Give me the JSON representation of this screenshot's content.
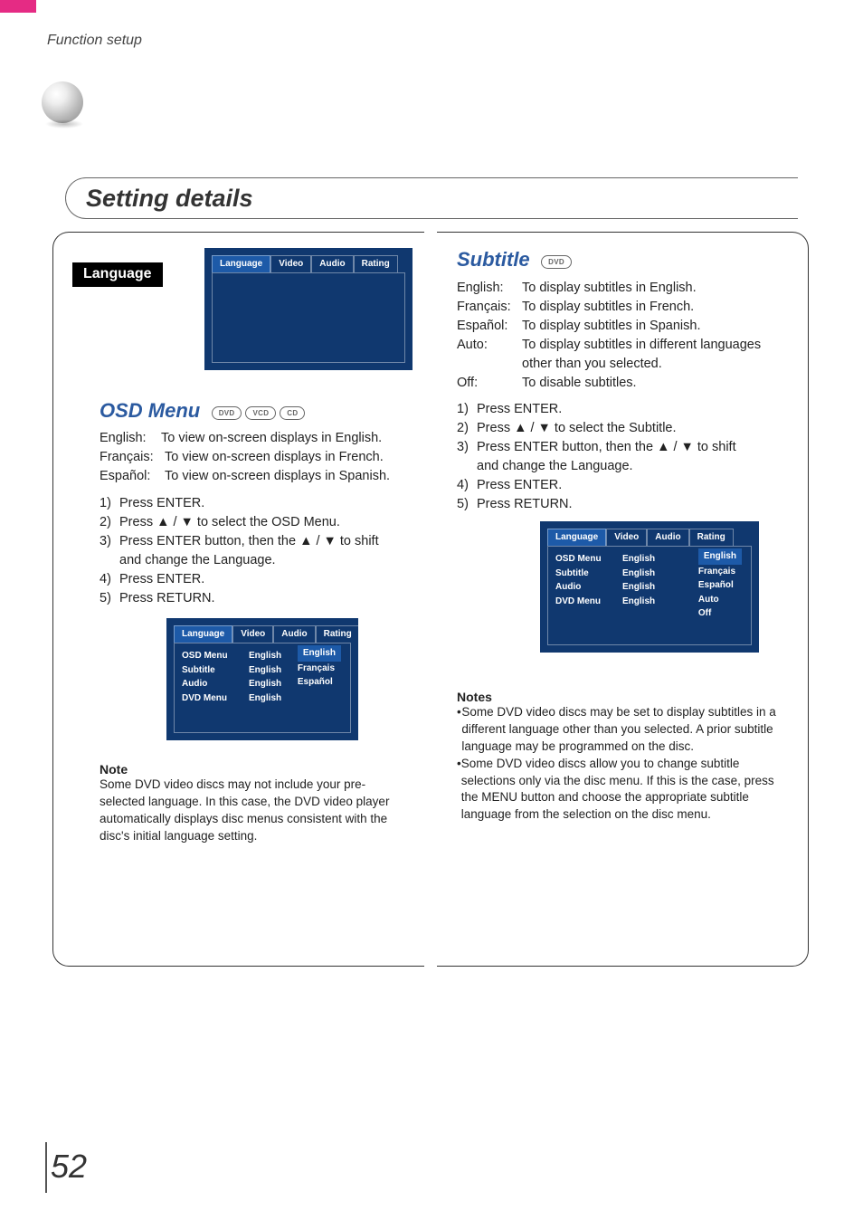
{
  "header": {
    "breadcrumb": "Function setup"
  },
  "title": "Setting details",
  "page_number": "52",
  "left": {
    "language_tag": "Language",
    "osd_tabs_top": [
      "Language",
      "Video",
      "Audio",
      "Rating"
    ],
    "osd_menu": {
      "heading": "OSD Menu",
      "badges": [
        "DVD",
        "VCD",
        "CD"
      ],
      "desc": [
        {
          "k": "English:",
          "v": "To view on-screen displays in English."
        },
        {
          "k": "Français:",
          "v": "To view on-screen displays in French."
        },
        {
          "k": "Español:",
          "v": "To view on-screen displays in Spanish."
        }
      ],
      "steps": [
        "Press ENTER.",
        "Press ▲ / ▼ to select the OSD Menu.",
        "Press ENTER button, then the ▲ / ▼ to shift",
        "and change the Language.",
        "Press ENTER.",
        "Press RETURN."
      ],
      "osd_screenshot": {
        "tabs": [
          "Language",
          "Video",
          "Audio",
          "Rating"
        ],
        "rows": [
          {
            "label": "OSD Menu",
            "val": "English"
          },
          {
            "label": "Subtitle",
            "val": "English"
          },
          {
            "label": "Audio",
            "val": "English"
          },
          {
            "label": "DVD Menu",
            "val": "English"
          }
        ],
        "options": [
          "English",
          "Français",
          "Español"
        ]
      },
      "note_h": "Note",
      "note_p": "Some DVD video discs may not include your pre-selected language. In this case, the DVD video player automatically displays disc menus consistent with the disc's initial language setting."
    }
  },
  "right": {
    "subtitle": {
      "heading": "Subtitle",
      "badges": [
        "DVD"
      ],
      "desc": [
        {
          "k": "English:",
          "v": "To display subtitles in English."
        },
        {
          "k": "Français:",
          "v": "To display subtitles in French."
        },
        {
          "k": "Español:",
          "v": "To display subtitles in Spanish."
        },
        {
          "k": "Auto:",
          "v": "To display subtitles in different languages"
        },
        {
          "k": "",
          "v": "other than you selected."
        },
        {
          "k": "Off:",
          "v": "To disable subtitles."
        }
      ],
      "steps": [
        "Press ENTER.",
        "Press ▲ / ▼ to select the Subtitle.",
        "Press ENTER button, then the ▲ / ▼ to shift",
        "and change the Language.",
        "Press ENTER.",
        "Press RETURN."
      ],
      "osd_screenshot": {
        "tabs": [
          "Language",
          "Video",
          "Audio",
          "Rating"
        ],
        "rows": [
          {
            "label": "OSD Menu",
            "val": "English"
          },
          {
            "label": "Subtitle",
            "val": "English"
          },
          {
            "label": "Audio",
            "val": "English"
          },
          {
            "label": "DVD Menu",
            "val": "English"
          }
        ],
        "options": [
          "English",
          "Français",
          "Español",
          "Auto",
          "Off"
        ]
      },
      "notes_h": "Notes",
      "notes": [
        "Some DVD video discs may be set to display subtitles in a different language other than you selected. A prior subtitle language may be programmed on the disc.",
        "Some DVD video discs allow you to change subtitle selections only via the disc menu. If this is the case, press the MENU button and choose the appropriate subtitle language from the selection on the disc menu."
      ]
    }
  }
}
